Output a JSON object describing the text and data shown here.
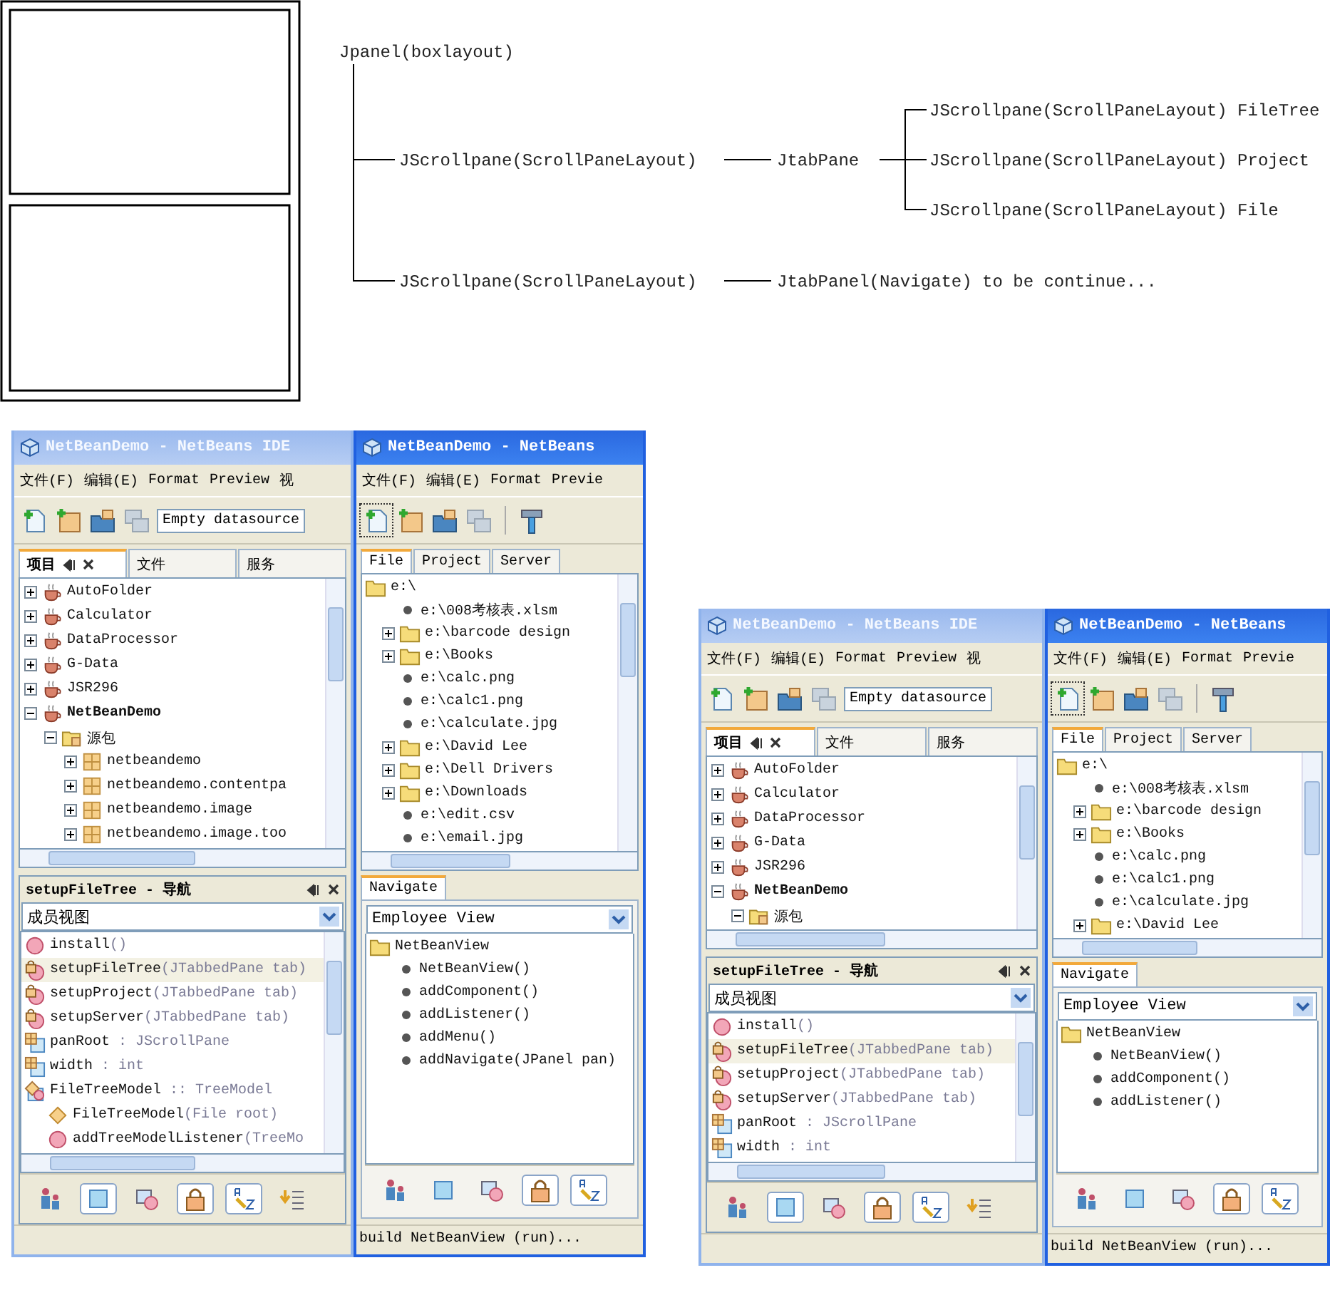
{
  "diagram": {
    "root": "Jpanel(boxlayout)",
    "branches": [
      {
        "label": "JScrollpane(ScrollPaneLayout)",
        "next": "JtabPane",
        "children": [
          "JScrollpane(ScrollPaneLayout) FileTree",
          "JScrollpane(ScrollPaneLayout) Project",
          "JScrollpane(ScrollPaneLayout) File"
        ]
      },
      {
        "label": "JScrollpane(ScrollPaneLayout)",
        "next": "JtabPanel(Navigate) to be continue..."
      }
    ]
  },
  "screenshots": [
    {
      "back": {
        "title": "NetBeanDemo - NetBeans IDE",
        "menu": [
          "文件(F)",
          "编辑(E)",
          "Format",
          "Preview",
          "视"
        ],
        "datasource": "Empty datasource",
        "panel_tabs": [
          {
            "label": "项目",
            "selected": true
          },
          {
            "label": "文件",
            "selected": false
          },
          {
            "label": "服务",
            "selected": false
          }
        ],
        "projects": [
          {
            "label": "AutoFolder",
            "kind": "project",
            "main": false,
            "expanded": false
          },
          {
            "label": "Calculator",
            "kind": "project",
            "main": false,
            "expanded": false
          },
          {
            "label": "DataProcessor",
            "kind": "project",
            "main": false,
            "expanded": false
          },
          {
            "label": "G-Data",
            "kind": "project",
            "main": false,
            "expanded": false
          },
          {
            "label": "JSR296",
            "kind": "project",
            "main": false,
            "expanded": false
          },
          {
            "label": "NetBeanDemo",
            "kind": "project",
            "main": true,
            "expanded": true,
            "children": [
              {
                "label": "源包",
                "kind": "source",
                "expanded": true,
                "children": [
                  {
                    "label": "netbeandemo",
                    "kind": "package",
                    "expanded": false
                  },
                  {
                    "label": "netbeandemo.contentpa",
                    "kind": "package",
                    "expanded": false
                  },
                  {
                    "label": "netbeandemo.image",
                    "kind": "package",
                    "expanded": false
                  },
                  {
                    "label": "netbeandemo.image.too",
                    "kind": "package",
                    "expanded": false
                  }
                ]
              }
            ]
          }
        ],
        "navigator": {
          "title": "setupFileTree - 导航",
          "view": "成员视图",
          "members": [
            {
              "kind": "method",
              "name": "install",
              "signature": "()",
              "selected": false
            },
            {
              "kind": "locked",
              "name": "setupFileTree",
              "signature": "(JTabbedPane tab)",
              "selected": true
            },
            {
              "kind": "locked",
              "name": "setupProject",
              "signature": "(JTabbedPane tab)",
              "selected": false
            },
            {
              "kind": "locked",
              "name": "setupServer",
              "signature": "(JTabbedPane tab)",
              "selected": false
            },
            {
              "kind": "field",
              "name": "panRoot",
              "signature": " : JScrollPane",
              "selected": false
            },
            {
              "kind": "field",
              "name": "width",
              "signature": " : int",
              "selected": false
            },
            {
              "kind": "class",
              "name": "FileTreeModel",
              "signature": " :: TreeModel",
              "selected": false,
              "children": [
                {
                  "kind": "constructor",
                  "name": "FileTreeModel",
                  "signature": "(File root)",
                  "selected": false
                },
                {
                  "kind": "method",
                  "name": "addTreeModelListener",
                  "signature": "(TreeMo",
                  "selected": false
                }
              ]
            }
          ],
          "filters": [
            {
              "kind": "inherited",
              "on": false
            },
            {
              "kind": "fields",
              "on": true
            },
            {
              "kind": "static",
              "on": false
            },
            {
              "kind": "nonpublic",
              "on": true
            },
            {
              "kind": "sort",
              "on": true
            },
            {
              "kind": "order",
              "on": false
            }
          ]
        }
      },
      "front": {
        "title": "NetBeanDemo - NetBeans",
        "menu": [
          "文件(F)",
          "编辑(E)",
          "Format",
          "Previe"
        ],
        "tabs": [
          {
            "label": "File",
            "selected": true
          },
          {
            "label": "Project",
            "selected": false
          },
          {
            "label": "Server",
            "selected": false
          }
        ],
        "files": [
          {
            "label": "e:\\",
            "kind": "folder",
            "children": [
              {
                "label": "e:\\008考核表.xlsm",
                "kind": "file"
              },
              {
                "label": "e:\\barcode design",
                "kind": "folder",
                "expanded": false
              },
              {
                "label": "e:\\Books",
                "kind": "folder",
                "expanded": false
              },
              {
                "label": "e:\\calc.png",
                "kind": "file"
              },
              {
                "label": "e:\\calc1.png",
                "kind": "file"
              },
              {
                "label": "e:\\calculate.jpg",
                "kind": "file"
              },
              {
                "label": "e:\\David Lee",
                "kind": "folder",
                "expanded": false
              },
              {
                "label": "e:\\Dell Drivers",
                "kind": "folder",
                "expanded": false
              },
              {
                "label": "e:\\Downloads",
                "kind": "folder",
                "expanded": false
              },
              {
                "label": "e:\\edit.csv",
                "kind": "file"
              },
              {
                "label": "e:\\email.jpg",
                "kind": "file"
              }
            ]
          }
        ],
        "navigate_tab": {
          "label": "Navigate",
          "selected": true
        },
        "view": "Employee View",
        "outline": [
          {
            "label": "NetBeanView",
            "kind": "folder",
            "children": [
              {
                "label": "NetBeanView()",
                "kind": "file"
              },
              {
                "label": "addComponent()",
                "kind": "file"
              },
              {
                "label": "addListener()",
                "kind": "file"
              },
              {
                "label": "addMenu()",
                "kind": "file"
              },
              {
                "label": "addNavigate(JPanel pan)",
                "kind": "file"
              }
            ]
          }
        ],
        "filters": [
          {
            "kind": "inherited",
            "on": false
          },
          {
            "kind": "fields",
            "on": false
          },
          {
            "kind": "static",
            "on": false
          },
          {
            "kind": "nonpublic",
            "on": true
          },
          {
            "kind": "sort",
            "on": true
          }
        ],
        "status": "build NetBeanView (run)..."
      }
    },
    {
      "back": {
        "title": "NetBeanDemo - NetBeans IDE",
        "menu": [
          "文件(F)",
          "编辑(E)",
          "Format",
          "Preview",
          "视"
        ],
        "datasource": "Empty datasource",
        "panel_tabs": [
          {
            "label": "项目",
            "selected": true
          },
          {
            "label": "文件",
            "selected": false
          },
          {
            "label": "服务",
            "selected": false
          }
        ],
        "projects": [
          {
            "label": "AutoFolder",
            "kind": "project",
            "main": false,
            "expanded": false
          },
          {
            "label": "Calculator",
            "kind": "project",
            "main": false,
            "expanded": false
          },
          {
            "label": "DataProcessor",
            "kind": "project",
            "main": false,
            "expanded": false
          },
          {
            "label": "G-Data",
            "kind": "project",
            "main": false,
            "expanded": false
          },
          {
            "label": "JSR296",
            "kind": "project",
            "main": false,
            "expanded": false
          },
          {
            "label": "NetBeanDemo",
            "kind": "project",
            "main": true,
            "expanded": true,
            "children": [
              {
                "label": "源包",
                "kind": "source",
                "expanded": true
              }
            ]
          }
        ],
        "navigator": {
          "title": "setupFileTree - 导航",
          "view": "成员视图",
          "members": [
            {
              "kind": "method",
              "name": "install",
              "signature": "()",
              "selected": false
            },
            {
              "kind": "locked",
              "name": "setupFileTree",
              "signature": "(JTabbedPane tab)",
              "selected": true
            },
            {
              "kind": "locked",
              "name": "setupProject",
              "signature": "(JTabbedPane tab)",
              "selected": false
            },
            {
              "kind": "locked",
              "name": "setupServer",
              "signature": "(JTabbedPane tab)",
              "selected": false
            },
            {
              "kind": "field",
              "name": "panRoot",
              "signature": " : JScrollPane",
              "selected": false
            },
            {
              "kind": "field",
              "name": "width",
              "signature": " : int",
              "selected": false
            }
          ],
          "filters": [
            {
              "kind": "inherited",
              "on": false
            },
            {
              "kind": "fields",
              "on": true
            },
            {
              "kind": "static",
              "on": false
            },
            {
              "kind": "nonpublic",
              "on": true
            },
            {
              "kind": "sort",
              "on": true
            },
            {
              "kind": "order",
              "on": false
            }
          ]
        }
      },
      "front": {
        "title": "NetBeanDemo - NetBeans",
        "menu": [
          "文件(F)",
          "编辑(E)",
          "Format",
          "Previe"
        ],
        "tabs": [
          {
            "label": "File",
            "selected": true
          },
          {
            "label": "Project",
            "selected": false
          },
          {
            "label": "Server",
            "selected": false
          }
        ],
        "files": [
          {
            "label": "e:\\",
            "kind": "folder",
            "children": [
              {
                "label": "e:\\008考核表.xlsm",
                "kind": "file"
              },
              {
                "label": "e:\\barcode design",
                "kind": "folder",
                "expanded": false
              },
              {
                "label": "e:\\Books",
                "kind": "folder",
                "expanded": false
              },
              {
                "label": "e:\\calc.png",
                "kind": "file"
              },
              {
                "label": "e:\\calc1.png",
                "kind": "file"
              },
              {
                "label": "e:\\calculate.jpg",
                "kind": "file"
              },
              {
                "label": "e:\\David Lee",
                "kind": "folder",
                "expanded": false
              }
            ]
          }
        ],
        "navigate_tab": {
          "label": "Navigate",
          "selected": true
        },
        "view": "Employee View",
        "outline": [
          {
            "label": "NetBeanView",
            "kind": "folder",
            "children": [
              {
                "label": "NetBeanView()",
                "kind": "file"
              },
              {
                "label": "addComponent()",
                "kind": "file"
              },
              {
                "label": "addListener()",
                "kind": "file"
              }
            ]
          }
        ],
        "filters": [
          {
            "kind": "inherited",
            "on": false
          },
          {
            "kind": "fields",
            "on": false
          },
          {
            "kind": "static",
            "on": false
          },
          {
            "kind": "nonpublic",
            "on": true
          },
          {
            "kind": "sort",
            "on": true
          }
        ],
        "status": "build NetBeanView (run)..."
      }
    }
  ]
}
